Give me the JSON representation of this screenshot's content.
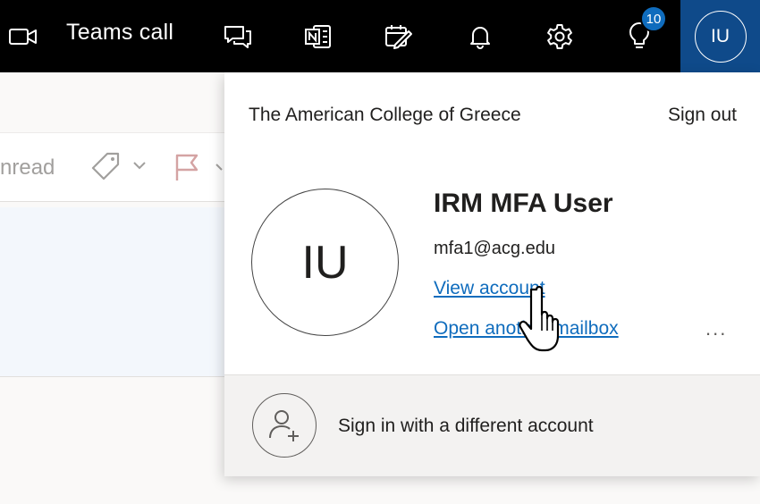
{
  "topbar": {
    "teams_call_label": "Teams call",
    "tips_badge_count": "10",
    "me_initials": "IU",
    "icons": [
      "video-camera-icon",
      "chat-icon",
      "onenote-icon",
      "my-day-icon",
      "bell-icon",
      "gear-icon",
      "lightbulb-icon"
    ]
  },
  "background": {
    "unread_fragment": "nread"
  },
  "account_flyout": {
    "organization": "The American College of Greece",
    "sign_out_label": "Sign out",
    "avatar_initials": "IU",
    "user_name": "IRM MFA User",
    "user_email": "mfa1@acg.edu",
    "view_account_label": "View account",
    "open_mailbox_label": "Open another mailbox",
    "more_options": "...",
    "different_account_label": "Sign in with a different account"
  },
  "colors": {
    "topbar_bg": "#000000",
    "me_button_bg": "#0f4a8a",
    "link": "#0f6cbd",
    "badge": "#0f6cbd"
  }
}
